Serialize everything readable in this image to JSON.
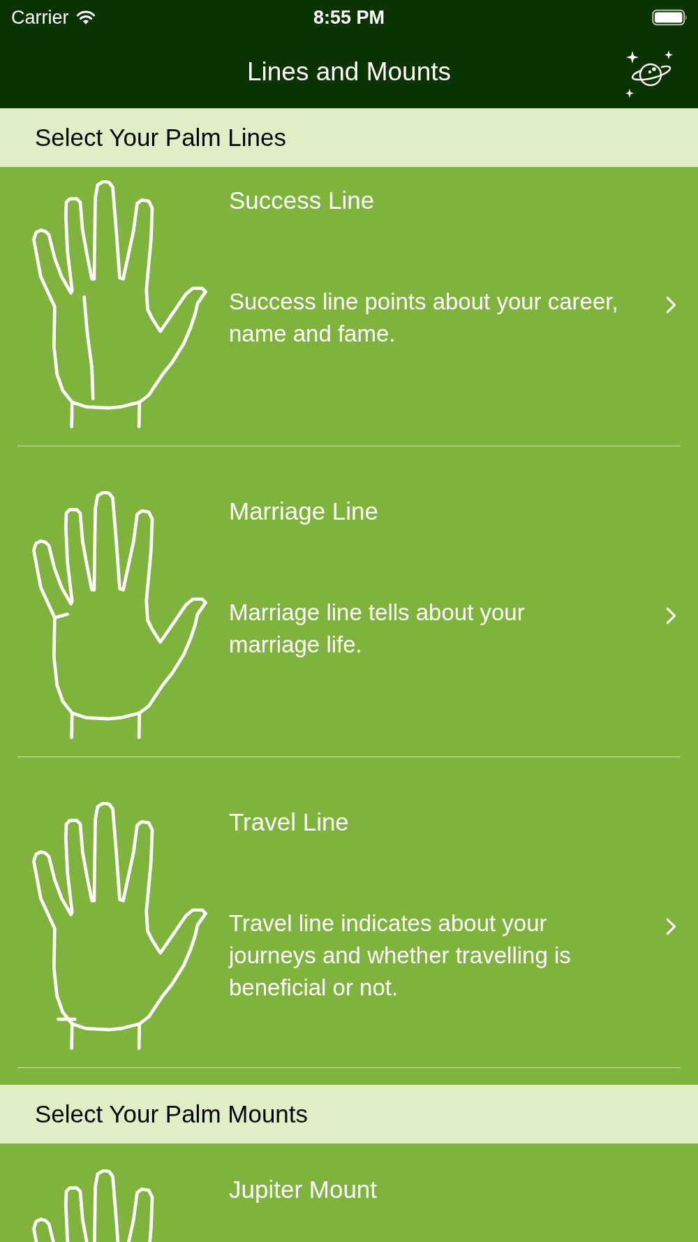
{
  "status_bar": {
    "carrier": "Carrier",
    "time": "8:55 PM"
  },
  "nav_bar": {
    "title": "Lines and Mounts"
  },
  "sections": [
    {
      "header": "Select Your Palm Lines",
      "items": [
        {
          "title": "Success Line",
          "description": "Success line points about your career, name and fame.",
          "kind": "success"
        },
        {
          "title": "Marriage Line",
          "description": "Marriage line tells about your marriage life.",
          "kind": "marriage"
        },
        {
          "title": "Travel Line",
          "description": "Travel line indicates about your journeys and whether travelling is beneficial or not.",
          "kind": "travel"
        }
      ]
    },
    {
      "header": "Select Your Palm Mounts",
      "items": [
        {
          "title": "Jupiter Mount",
          "kind": "mount"
        }
      ]
    }
  ]
}
